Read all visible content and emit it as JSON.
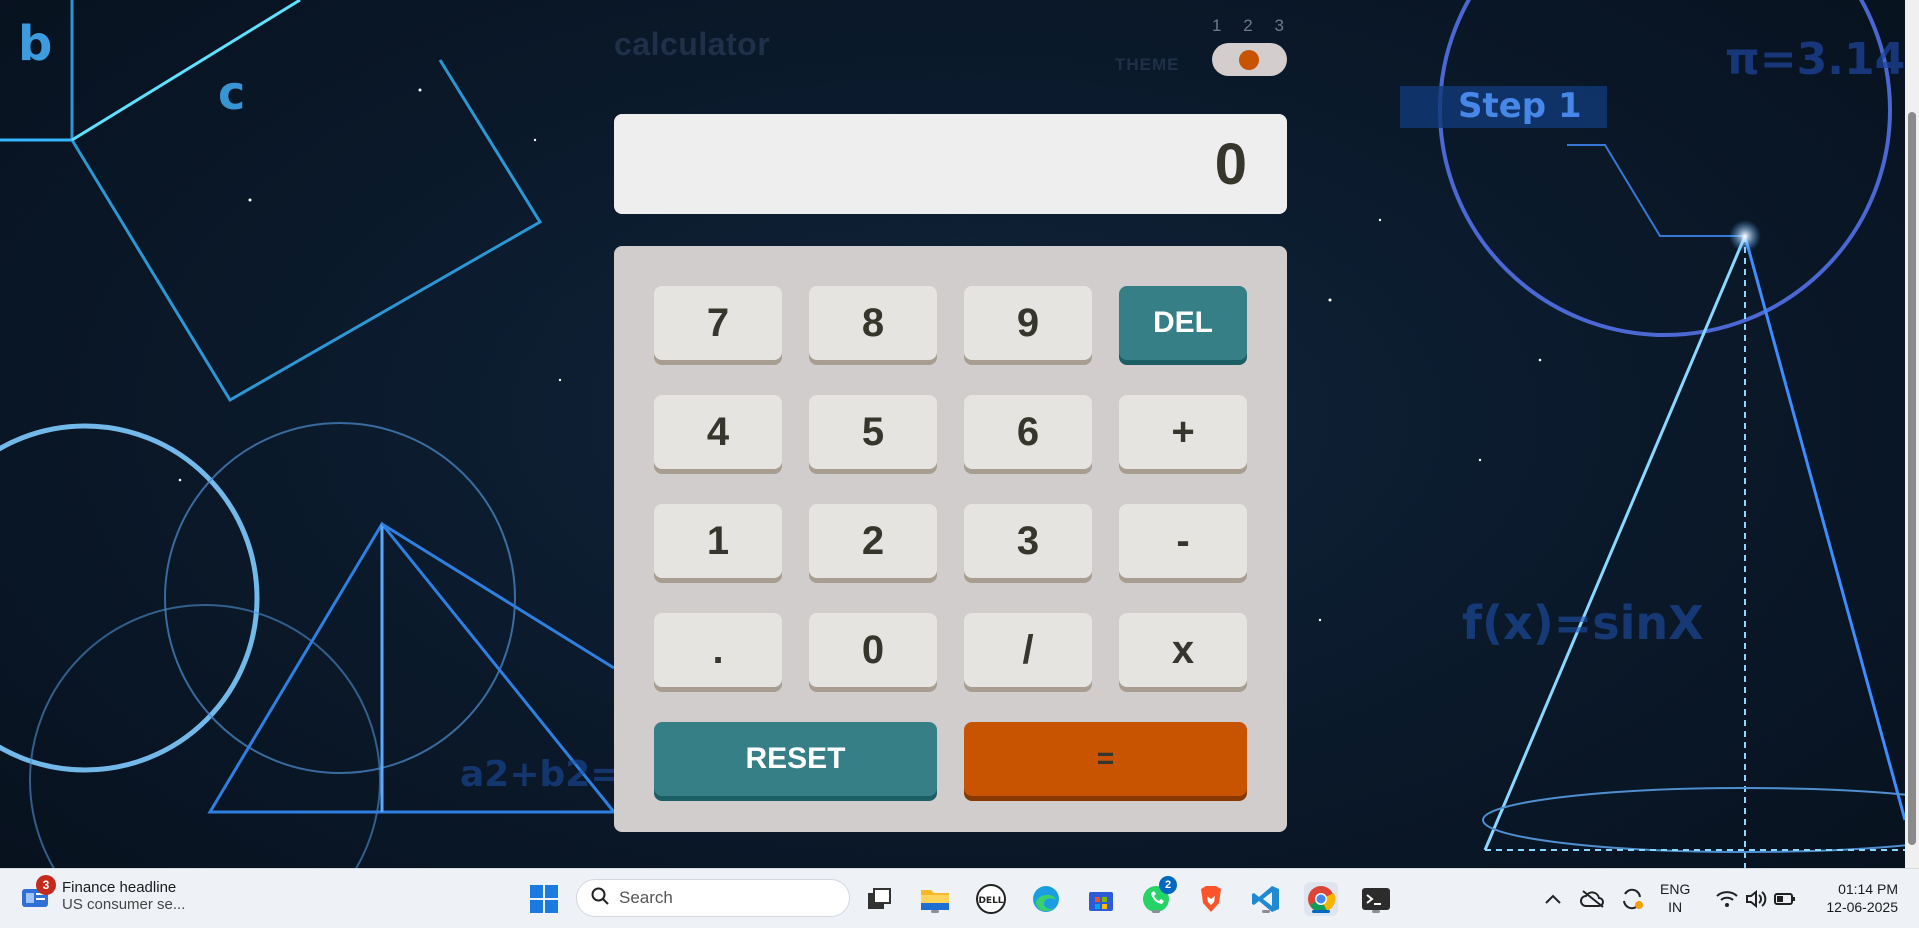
{
  "background": {
    "labels": [
      "b",
      "c",
      "Step 1",
      "π=3.14",
      "f(x)=sinX",
      "a2+b2="
    ]
  },
  "calculator": {
    "title": "calculator",
    "theme_label": "THEME",
    "theme_options": [
      "1",
      "2",
      "3"
    ],
    "theme_selected": 2,
    "display_value": "0",
    "keys": {
      "k7": "7",
      "k8": "8",
      "k9": "9",
      "del": "DEL",
      "k4": "4",
      "k5": "5",
      "k6": "6",
      "plus": "+",
      "k1": "1",
      "k2": "2",
      "k3": "3",
      "minus": "-",
      "dot": ".",
      "k0": "0",
      "divide": "/",
      "multiply": "x",
      "reset": "RESET",
      "equals": "="
    },
    "colors": {
      "accent": "#c85402",
      "secondary": "#377f86",
      "keypad_bg": "#d2cdcd"
    }
  },
  "taskbar": {
    "news": {
      "badge": "3",
      "title": "Finance headline",
      "subtitle": "US consumer se..."
    },
    "search_placeholder": "Search",
    "whatsapp_badge": "2",
    "lang_top": "ENG",
    "lang_bottom": "IN",
    "time": "01:14 PM",
    "date": "12-06-2025"
  }
}
